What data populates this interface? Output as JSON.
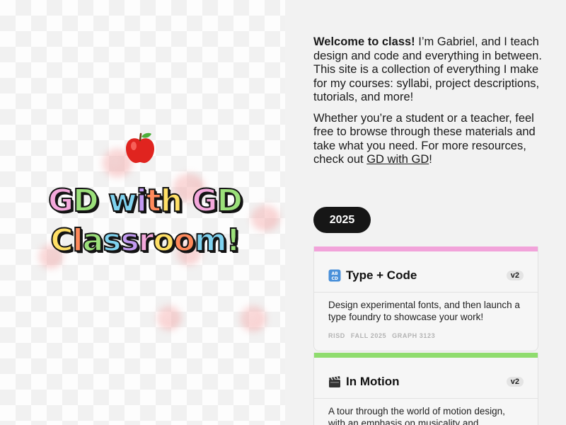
{
  "hero": {
    "title_line1": [
      "G",
      "D",
      " ",
      "w",
      "i",
      "t",
      "h",
      " ",
      "G",
      "D"
    ],
    "title_line2": [
      "C",
      "l",
      "a",
      "s",
      "s",
      "r",
      "o",
      "o",
      "m",
      "!"
    ],
    "line1_colors": [
      "#f4a8dc",
      "#9be07a",
      "",
      "#7fd3f0",
      "#c39bf2",
      "#ff8a5c",
      "#ffe066",
      "",
      "#f4a8dc",
      "#9be07a"
    ],
    "line2_colors": [
      "#ffe066",
      "#ff8a5c",
      "#9be07a",
      "#7fd3f0",
      "#c39bf2",
      "#f4a8dc",
      "#ffe066",
      "#ff8a5c",
      "#7fd3f0",
      "#9be07a"
    ],
    "emoji": "red-apple"
  },
  "intro": {
    "p1_bold": "Welcome to class!",
    "p1_rest": " I’m Gabriel, and I teach design and code and everything in between. This site is a collection of everything I make for my courses: syllabi, project descriptions, tutorials, and more!",
    "p2_before": "Whether you’re a student or a teacher, feel free to browse through these materials and take what you need. For more resources, check out ",
    "p2_link": "GD with GD",
    "p2_after": "!"
  },
  "year": "2025",
  "courses": [
    {
      "title": "Type + Code",
      "version": "v2",
      "description": "Design experimental fonts, and then launch a type foundry to showcase your work!",
      "tags": [
        "RISD",
        "FALL 2025",
        "GRAPH 3123"
      ],
      "accent": "#f2a3da",
      "icon": "abcd-input-icon"
    },
    {
      "title": "In Motion",
      "version": "v2",
      "description": "A tour through the world of motion design, with an emphasis on musicality and performance!",
      "tags": [],
      "accent": "#8fdc6e",
      "icon": "clapper-board-icon"
    }
  ]
}
